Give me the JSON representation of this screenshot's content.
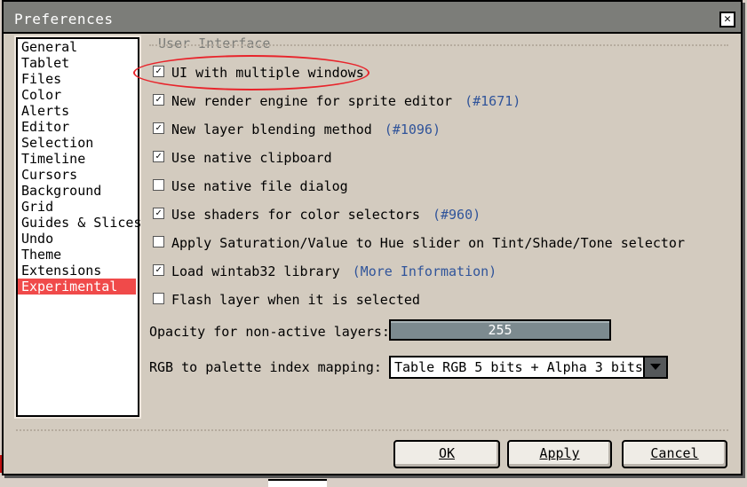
{
  "window": {
    "title": "Preferences"
  },
  "sidebar": {
    "items": [
      {
        "label": "General"
      },
      {
        "label": "Tablet"
      },
      {
        "label": "Files"
      },
      {
        "label": "Color"
      },
      {
        "label": "Alerts"
      },
      {
        "label": "Editor"
      },
      {
        "label": "Selection"
      },
      {
        "label": "Timeline"
      },
      {
        "label": "Cursors"
      },
      {
        "label": "Background"
      },
      {
        "label": "Grid"
      },
      {
        "label": "Guides & Slices"
      },
      {
        "label": "Undo"
      },
      {
        "label": "Theme"
      },
      {
        "label": "Extensions"
      },
      {
        "label": "Experimental"
      }
    ],
    "selected": "Experimental"
  },
  "group": {
    "label": "User Interface"
  },
  "options": [
    {
      "label": "UI with multiple windows",
      "checked": true,
      "link": ""
    },
    {
      "label": "New render engine for sprite editor",
      "checked": true,
      "link": "(#1671)"
    },
    {
      "label": "New layer blending method",
      "checked": true,
      "link": "(#1096)"
    },
    {
      "label": "Use native clipboard",
      "checked": true,
      "link": ""
    },
    {
      "label": "Use native file dialog",
      "checked": false,
      "link": ""
    },
    {
      "label": "Use shaders for color selectors",
      "checked": true,
      "link": "(#960)"
    },
    {
      "label": "Apply Saturation/Value to Hue slider on Tint/Shade/Tone selector",
      "checked": false,
      "link": ""
    },
    {
      "label": "Load wintab32 library",
      "checked": true,
      "link": "(More Information)"
    },
    {
      "label": "Flash layer when it is selected",
      "checked": false,
      "link": ""
    }
  ],
  "opacity": {
    "label": "Opacity for non-active layers:",
    "value": "255"
  },
  "rgb_mapping": {
    "label": "RGB to palette index mapping:",
    "value": "Table RGB 5 bits + Alpha 3 bits"
  },
  "buttons": {
    "ok": "OK",
    "apply": "Apply",
    "cancel": "Cancel"
  },
  "icons": {
    "close": "close-icon",
    "checkbox": "check-icon",
    "dropdown": "triangle-down-icon"
  },
  "colors": {
    "accent": "#f04a4a",
    "link": "#30549a",
    "titlebar": "#7c7d79",
    "annotation": "#e8242b"
  }
}
